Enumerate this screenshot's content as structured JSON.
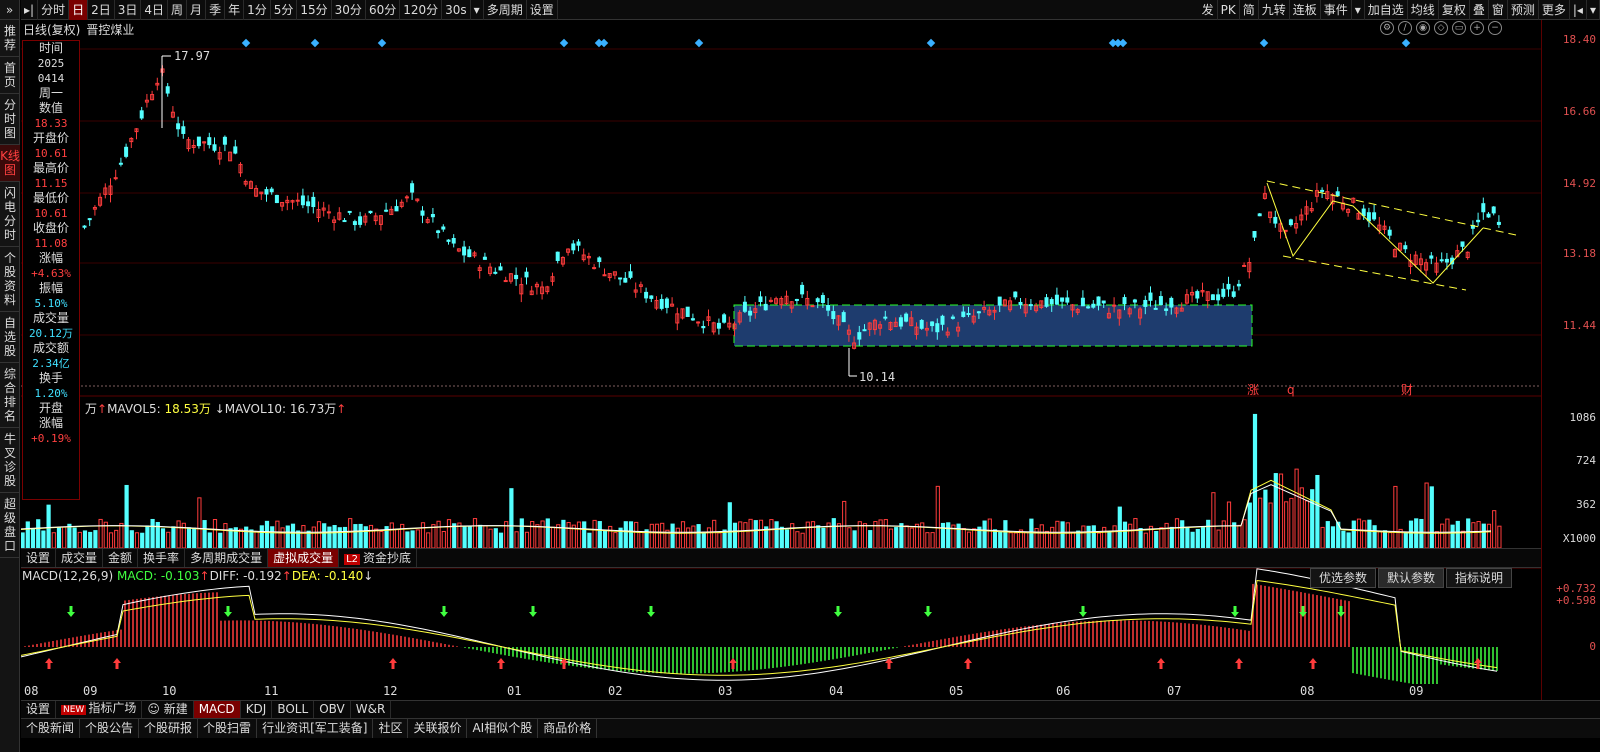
{
  "left_sidebar": {
    "top": "»",
    "items": [
      {
        "label": "推荐"
      },
      {
        "label": "首页"
      },
      {
        "label": "分时图"
      },
      {
        "label": "K线图",
        "active": true
      },
      {
        "label": "闪电分时"
      },
      {
        "label": "个股资料"
      },
      {
        "label": "自选股"
      },
      {
        "label": "综合排名"
      },
      {
        "label": "牛叉诊股"
      },
      {
        "label": "超级盘口"
      }
    ]
  },
  "toolbar": {
    "play": "▸|",
    "items": [
      "分时",
      "日",
      "2日",
      "3日",
      "4日",
      "周",
      "月",
      "季",
      "年",
      "1分",
      "5分",
      "15分",
      "30分",
      "60分",
      "120分",
      "30s",
      "多周期",
      "设置"
    ],
    "active": "日",
    "dropdown_after": "30s",
    "right": [
      "发",
      "PK",
      "简",
      "九转",
      "连板",
      "事件",
      "加自选",
      "均线",
      "复权",
      "叠",
      "窗",
      "预测",
      "更多"
    ],
    "right_icon": "|◂"
  },
  "subheader": {
    "mode": "日线(复权)",
    "stock": "晋控煤业"
  },
  "price_axis": [
    "18.40",
    "16.66",
    "14.92",
    "13.18",
    "11.44"
  ],
  "annotations": {
    "high": "17.97",
    "low": "10.14",
    "events": [
      "涨",
      "q",
      "财"
    ]
  },
  "info_panel": [
    {
      "label": "时间",
      "value": "2025",
      "cls": "white"
    },
    {
      "label": "",
      "value": "0414",
      "cls": "white"
    },
    {
      "label": "周一",
      "value": "",
      "cls": "white"
    },
    {
      "label": "数值",
      "value": "18.33",
      "cls": "red"
    },
    {
      "label": "开盘价",
      "value": "10.61",
      "cls": "red"
    },
    {
      "label": "最高价",
      "value": "11.15",
      "cls": "red"
    },
    {
      "label": "最低价",
      "value": "10.61",
      "cls": "red"
    },
    {
      "label": "收盘价",
      "value": "11.08",
      "cls": "red"
    },
    {
      "label": "涨幅",
      "value": "+4.63%",
      "cls": "red"
    },
    {
      "label": "振幅",
      "value": "5.10%",
      "cls": "cyan"
    },
    {
      "label": "成交量",
      "value": "20.12万",
      "cls": "cyan"
    },
    {
      "label": "成交额",
      "value": "2.34亿",
      "cls": "cyan"
    },
    {
      "label": "换手",
      "value": "1.20%",
      "cls": "cyan"
    },
    {
      "label": "开盘",
      "value": "",
      "cls": "red"
    },
    {
      "label": "涨幅",
      "value": "+0.19%",
      "cls": "red"
    }
  ],
  "volume": {
    "unit_prefix": "万",
    "mavol5_label": "MAVOL5:",
    "mavol5": "18.53万",
    "mavol10_label": "MAVOL10:",
    "mavol10": "16.73万",
    "axis": [
      "1086",
      "724",
      "362",
      "X1000"
    ]
  },
  "volume_tabs": [
    "设置",
    "成交量",
    "金额",
    "换手率",
    "多周期成交量",
    "虚拟成交量",
    "资金抄底"
  ],
  "volume_tab_active": "虚拟成交量",
  "l2": "L2",
  "macd": {
    "title": "MACD(12,26,9)",
    "macd_label": "MACD:",
    "macd": "-0.103",
    "diff_label": "DIFF:",
    "diff": "-0.192",
    "dea_label": "DEA:",
    "dea": "-0.140",
    "axis": [
      "+0.732",
      "+0.598",
      "0"
    ],
    "buttons": [
      "优选参数",
      "默认参数",
      "指标说明"
    ]
  },
  "x_axis": [
    "08",
    "09",
    "10",
    "11",
    "12",
    "01",
    "02",
    "03",
    "04",
    "05",
    "06",
    "07",
    "08",
    "09"
  ],
  "indicator_tabs": [
    "设置",
    "指标广场",
    "新建",
    "MACD",
    "KDJ",
    "BOLL",
    "OBV",
    "W&R"
  ],
  "indicator_active": "MACD",
  "new_badge": "NEW",
  "bottom_tabs": [
    "个股新闻",
    "个股公告",
    "个股研报",
    "个股扫雷",
    "行业资讯[军工装备]",
    "社区",
    "关联报价",
    "AI相似个股",
    "商品价格"
  ],
  "colors": {
    "up": "#ff3c3c",
    "down": "#54ffff",
    "box": "#1e3c6e",
    "dash_green": "#2aff2a",
    "trend": "#ffff40"
  }
}
